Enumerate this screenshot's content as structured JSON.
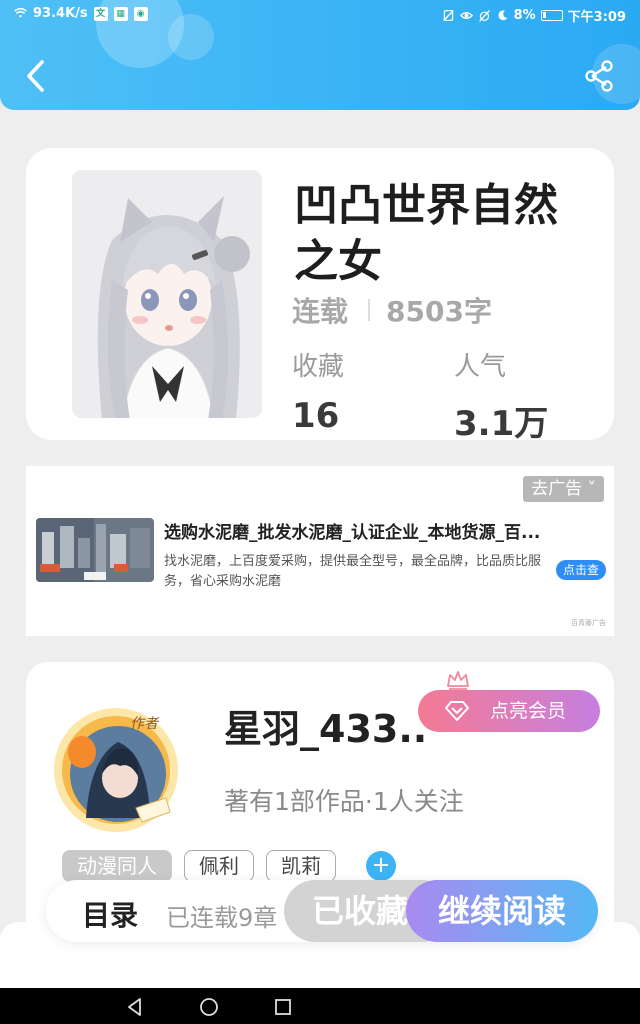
{
  "status_bar": {
    "speed": "93.4K/s",
    "battery": "8%",
    "time": "下午3:09"
  },
  "header": {
    "back_icon": "chevron-left-icon",
    "share_icon": "share-icon"
  },
  "book": {
    "title": "凹凸世界自然之女",
    "status": "连载",
    "word_count": "8503字",
    "stats": [
      {
        "label": "收藏",
        "value": "16"
      },
      {
        "label": "人气",
        "value": "3.1万"
      }
    ]
  },
  "ad": {
    "close_label": "去广告",
    "title": "选购水泥磨_批发水泥磨_认证企业_本地货源_百...",
    "description": "找水泥磨，上百度爱采购，提供最全型号，最全品牌，比品质比服务，省心采购水泥磨",
    "cta": "点击查",
    "source": "百青藤广告"
  },
  "author": {
    "badge": "作者",
    "name": "星羽_433..",
    "vip_label": "点亮会员",
    "meta": "著有1部作品·1人关注",
    "tags": [
      "动漫同人",
      "佩利",
      "凯莉"
    ],
    "add_tag_icon": "plus-icon"
  },
  "bottom_bar": {
    "toc_label": "目录",
    "toc_count": "已连载9章",
    "collected_label": "已收藏",
    "read_label": "继续阅读"
  },
  "colors": {
    "header": "#38b2f5",
    "accent": "#3db4f6",
    "vip_start": "#f47a93",
    "vip_end": "#c57fe0"
  }
}
